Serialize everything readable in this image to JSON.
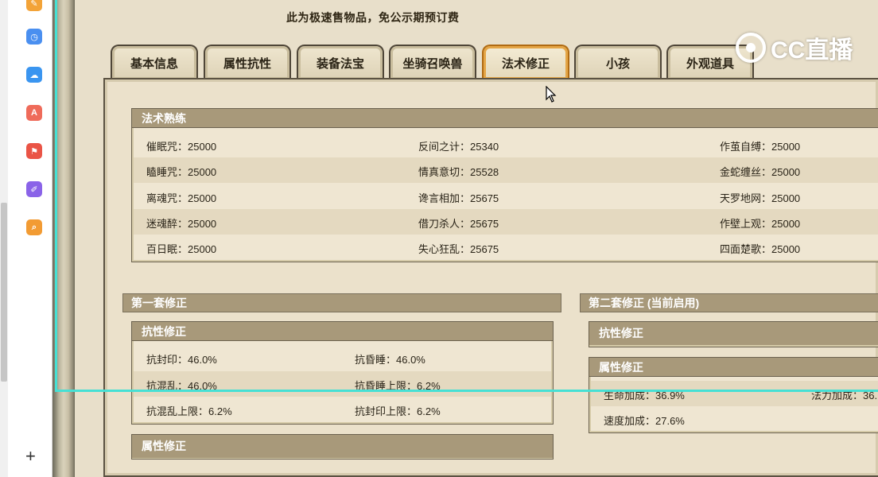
{
  "notice": "此为极速售物品，免公示期预订费",
  "tabs": [
    {
      "label": "基本信息",
      "active": false
    },
    {
      "label": "属性抗性",
      "active": false
    },
    {
      "label": "装备法宝",
      "active": false
    },
    {
      "label": "坐骑召唤兽",
      "active": false
    },
    {
      "label": "法术修正",
      "active": true
    },
    {
      "label": "小孩",
      "active": false
    },
    {
      "label": "外观道具",
      "active": false
    }
  ],
  "spell_mastery": {
    "title": "法术熟练",
    "rows": [
      [
        "催眠咒：25000",
        "反间之计：25340",
        "作茧自缚：25000"
      ],
      [
        "瞌睡咒：25000",
        "情真意切：25528",
        "金蛇缠丝：25000"
      ],
      [
        "离魂咒：25000",
        "谗言相加：25675",
        "天罗地网：25000"
      ],
      [
        "迷魂醉：25000",
        "借刀杀人：25675",
        "作壁上观：25000"
      ],
      [
        "百日眠：25000",
        "失心狂乱：25675",
        "四面楚歌：25000"
      ]
    ]
  },
  "set1": {
    "title": "第一套修正",
    "resist": {
      "title": "抗性修正",
      "rows": [
        [
          "抗封印：46.0%",
          "抗昏睡：46.0%"
        ],
        [
          "抗混乱：46.0%",
          "抗昏睡上限：6.2%"
        ],
        [
          "抗混乱上限：6.2%",
          "抗封印上限：6.2%"
        ]
      ]
    },
    "attr": {
      "title": "属性修正"
    }
  },
  "set2": {
    "title": "第二套修正 (当前启用)",
    "resist": {
      "title": "抗性修正"
    },
    "attr": {
      "title": "属性修正",
      "rows": [
        [
          "生命加成：36.9%",
          "法力加成：36."
        ],
        [
          "速度加成：27.6%",
          ""
        ]
      ]
    }
  },
  "watermark": "CC直播",
  "colors": {
    "header_bar": "#a8997a",
    "active_tab_border": "#b06b13",
    "selection_outline": "#46e0d4"
  },
  "sidebar_icons": [
    "note-icon",
    "clock-icon",
    "cloud-icon",
    "translate-icon",
    "pdf-icon",
    "edit-icon",
    "search-icon"
  ]
}
